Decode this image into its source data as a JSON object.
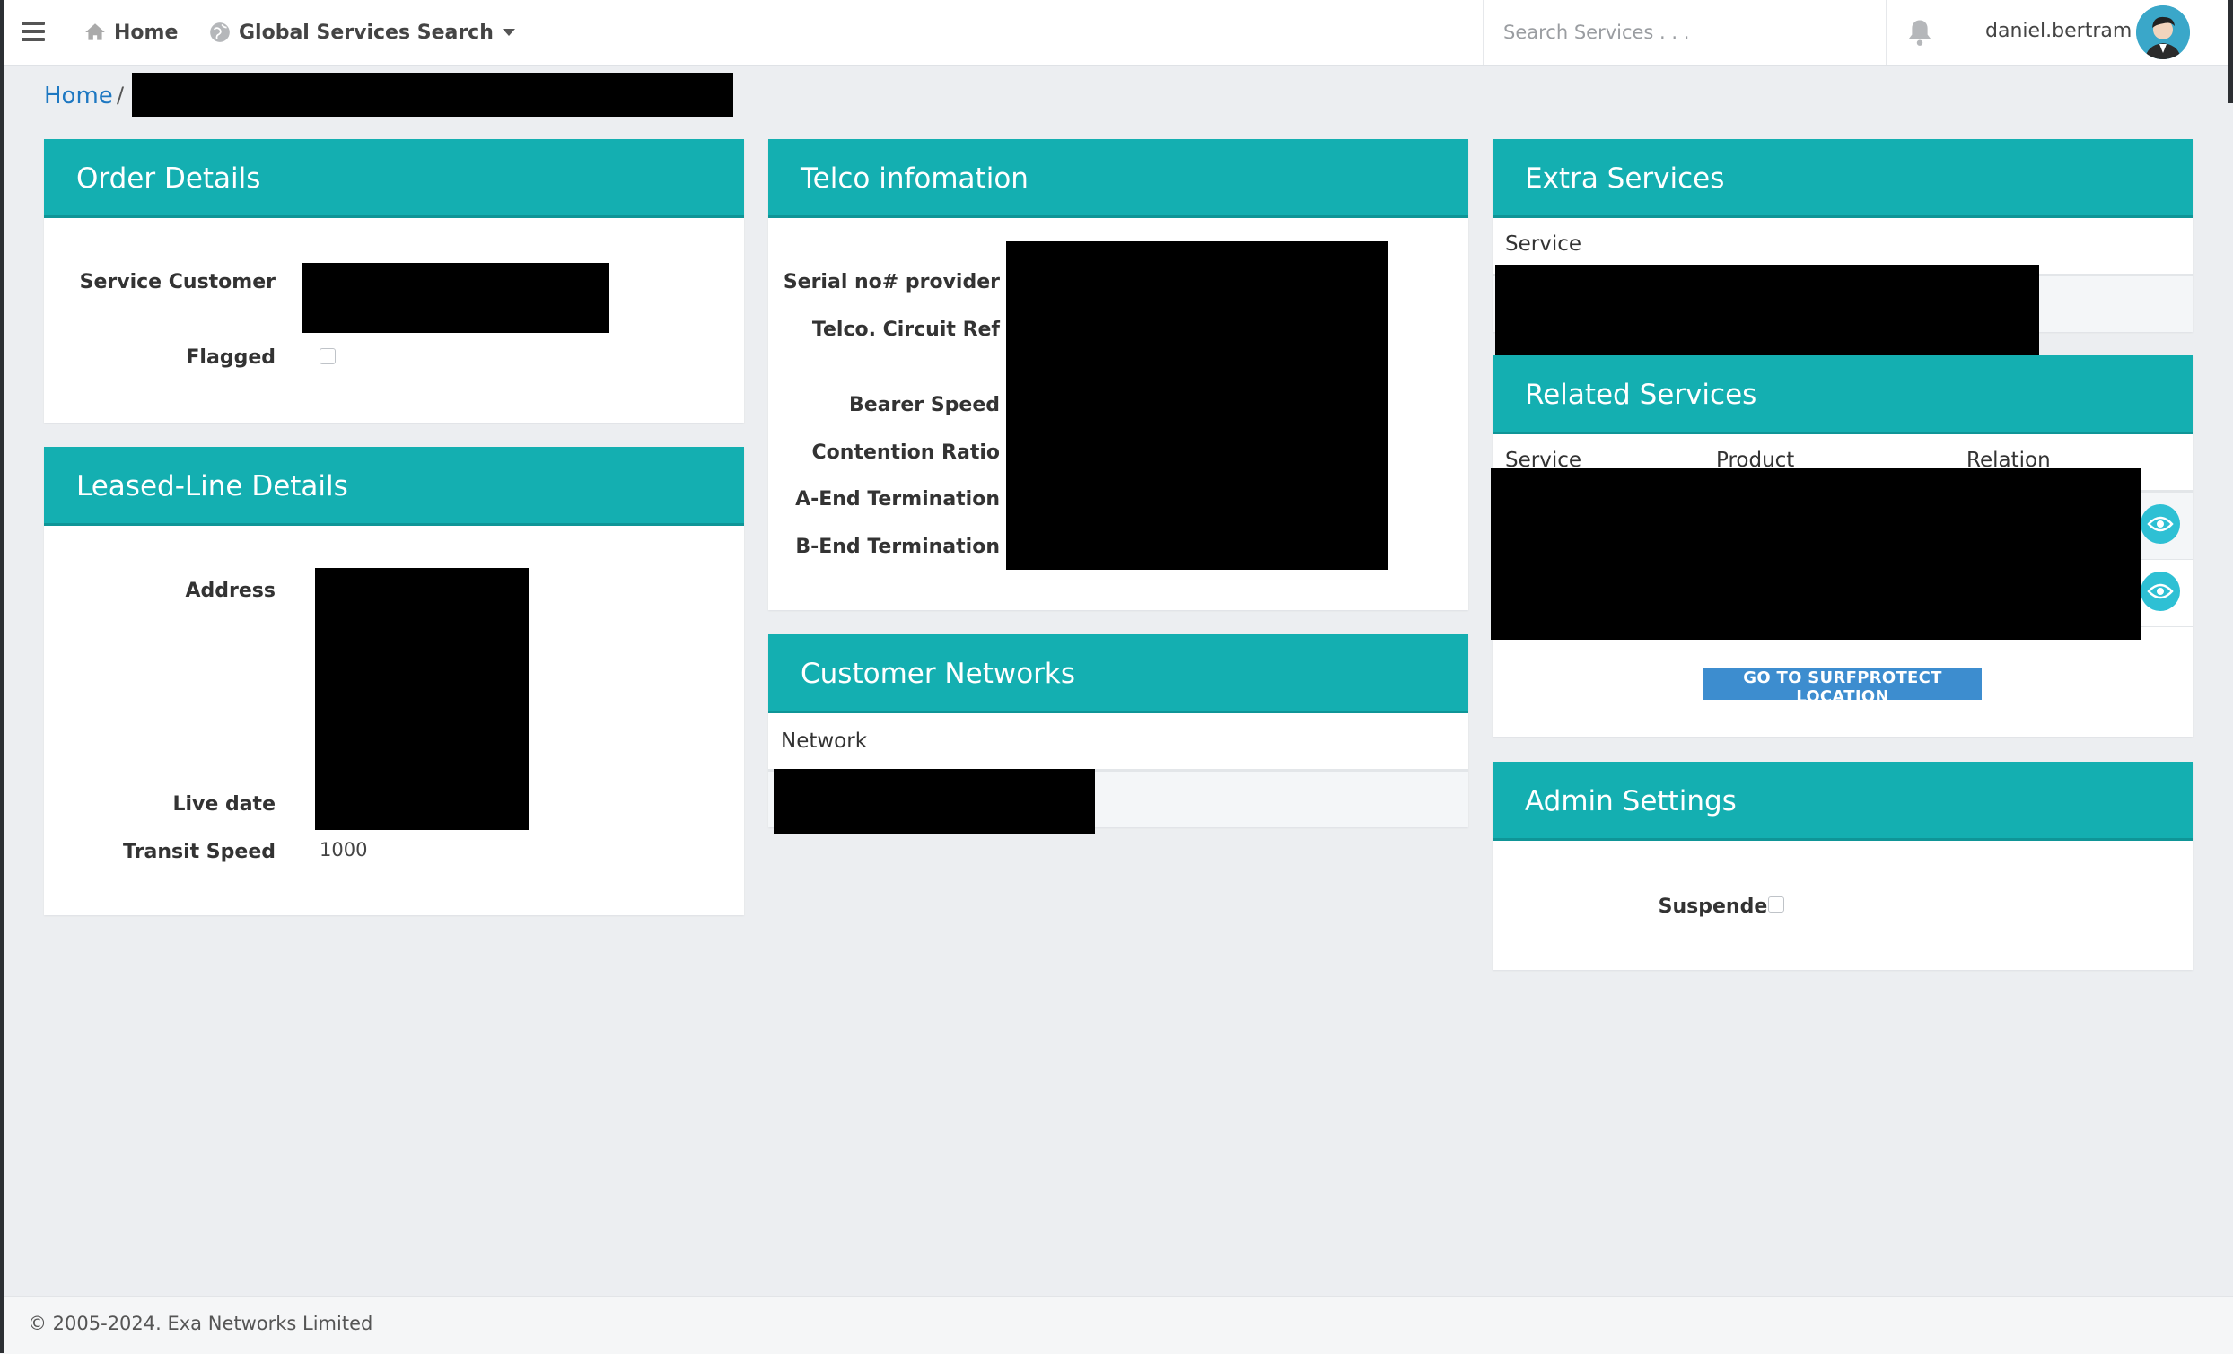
{
  "nav": {
    "home_label": "Home",
    "global_search_label": "Global Services Search",
    "search_placeholder": "Search Services . . .",
    "username": "daniel.bertram"
  },
  "breadcrumb": {
    "home": "Home",
    "separator": "/"
  },
  "order_details": {
    "title": "Order Details",
    "service_customer_label": "Service Customer",
    "flagged_label": "Flagged"
  },
  "leased_line": {
    "title": "Leased-Line Details",
    "address_label": "Address",
    "live_date_label": "Live date",
    "transit_speed_label": "Transit Speed",
    "transit_speed_value": "1000"
  },
  "telco": {
    "title": "Telco infomation",
    "serial_label": "Serial no# provider",
    "circuit_ref_label": "Telco. Circuit Ref",
    "bearer_speed_label": "Bearer Speed",
    "contention_label": "Contention Ratio",
    "a_end_label": "A-End Termination",
    "b_end_label": "B-End Termination"
  },
  "customer_networks": {
    "title": "Customer Networks",
    "col_network": "Network"
  },
  "extra_services": {
    "title": "Extra Services",
    "col_service": "Service"
  },
  "related_services": {
    "title": "Related Services",
    "col_service": "Service",
    "col_product": "Product",
    "col_relation": "Relation",
    "button": "GO TO SURFPROTECT LOCATION"
  },
  "admin": {
    "title": "Admin Settings",
    "suspended_label": "Suspended"
  },
  "footer": {
    "copyright": "© 2005-2024. Exa Networks Limited"
  },
  "colors": {
    "header": "#14afb1",
    "link": "#1e78c2",
    "button": "#3d8dcf",
    "eye": "#2ec0d4"
  }
}
